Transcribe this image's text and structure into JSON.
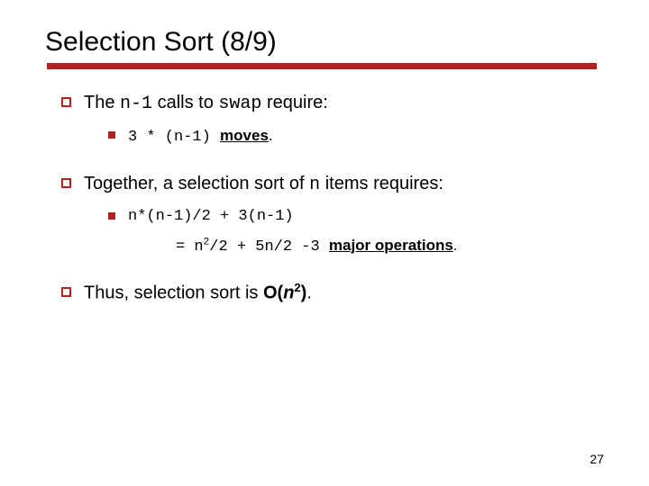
{
  "title": "Selection Sort (8/9)",
  "b1": {
    "pre": "The ",
    "code1": "n-1",
    "mid": " calls to ",
    "code2": "swap",
    "post": " require:"
  },
  "b1s1": {
    "code": "3 * (n-1) ",
    "word": "moves",
    "dot": "."
  },
  "b2": {
    "pre": "Together, a selection sort of ",
    "code": "n",
    "post": " items requires:"
  },
  "b2s1": {
    "line1": "n*(n-1)/2 + 3(n-1)",
    "line2_pre": "= n",
    "line2_sup1": "2",
    "line2_mid": "/2 + 5n/2 -3 ",
    "line2_word": "major operations",
    "line2_dot": "."
  },
  "b3": {
    "pre": "Thus, selection sort is ",
    "bigO_pre": "O(",
    "bigO_n": "n",
    "bigO_sup": "2",
    "bigO_post": ")",
    "dot": "."
  },
  "page": "27"
}
